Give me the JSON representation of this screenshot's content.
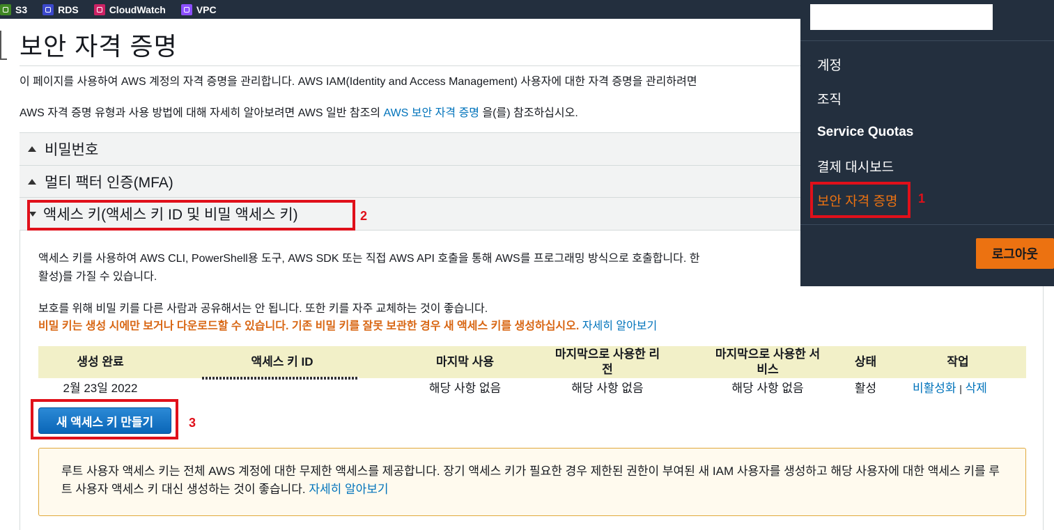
{
  "favorites": [
    {
      "label": "S3",
      "color": "#3f8624",
      "icon": "s3-icon"
    },
    {
      "label": "RDS",
      "color": "#3b48cc",
      "icon": "rds-icon"
    },
    {
      "label": "CloudWatch",
      "color": "#cc2264",
      "icon": "cloudwatch-icon"
    },
    {
      "label": "VPC",
      "color": "#8c4fff",
      "icon": "vpc-icon"
    }
  ],
  "page": {
    "title": "보안 자격 증명",
    "intro1": "이 페이지를 사용하여 AWS 계정의 자격 증명을 관리합니다. AWS IAM(Identity and Access Management) 사용자에 대한 자격 증명을 관리하려면",
    "intro2_before": "AWS 자격 증명 유형과 사용 방법에 대해 자세히 알아보려면 AWS 일반 참조의 ",
    "intro2_link": "AWS 보안 자격 증명",
    "intro2_after": " 을(를) 참조하십시오."
  },
  "sections": {
    "password": "비밀번호",
    "mfa": "멀티 팩터 인증(MFA)",
    "access_keys": "액세스 키(액세스 키 ID 및 비밀 액세스 키)"
  },
  "access_keys": {
    "desc1": "액세스 키를 사용하여 AWS CLI, PowerShell용 도구, AWS SDK 또는 직접 AWS API 호출을 통해 AWS를 프로그래밍 방식으로 호출합니다. 한",
    "desc2": "활성)를 가질 수 있습니다.",
    "protect": "보호를 위해 비밀 키를 다른 사람과 공유해서는 안 됩니다. 또한 키를 자주 교체하는 것이 좋습니다.",
    "warning": "비밀 키는 생성 시에만 보거나 다운로드할 수 있습니다. 기존 비밀 키를 잘못 보관한 경우 새 액세스 키를 생성하십시오.",
    "learn_more": "자세히 알아보기",
    "columns": {
      "created": "생성 완료",
      "key_id": "액세스 키 ID",
      "last_used": "마지막 사용",
      "last_region": "마지막으로 사용한 리전",
      "last_service": "마지막으로 사용한 서비스",
      "status": "상태",
      "actions": "작업"
    },
    "row": {
      "created": "2월 23일 2022",
      "last_used": "해당 사항 없음",
      "last_region": "해당 사항 없음",
      "last_service": "해당 사항 없음",
      "status": "활성",
      "deactivate": "비활성화",
      "separator": "|",
      "delete": "삭제"
    },
    "create_button": "새 액세스 키 만들기",
    "root_notice": "루트 사용자 액세스 키는 전체 AWS 계정에 대한 무제한 액세스를 제공합니다. 장기 액세스 키가 필요한 경우 제한된 권한이 부여된 새 IAM 사용자를 생성하고 해당 사용자에 대한 액세스 키를 루트 사용자 액세스 키 대신 생성하는 것이 좋습니다.",
    "root_notice_link": "자세히 알아보기"
  },
  "dropdown": {
    "items": [
      "계정",
      "조직",
      "Service Quotas",
      "결제 대시보드",
      "보안 자격 증명"
    ],
    "active_index": 4,
    "logout": "로그아웃"
  },
  "annotations": [
    "1",
    "2",
    "3"
  ],
  "colors": {
    "nav_bg": "#232f3e",
    "accent_orange": "#ec7211",
    "link_blue": "#0073bb",
    "warning_orange": "#d86613",
    "callout_red": "#e0101a"
  }
}
